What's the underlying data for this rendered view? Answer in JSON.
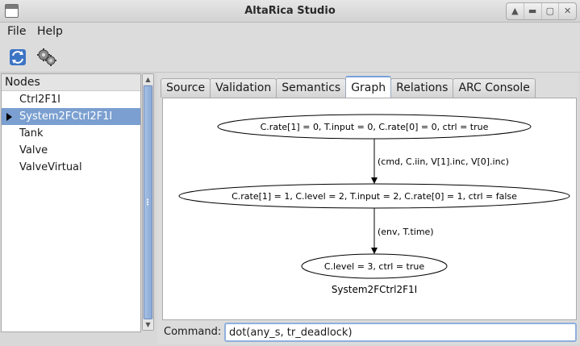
{
  "window": {
    "title": "AltaRica Studio",
    "controls": [
      "▲",
      "▬",
      "▢",
      "✕"
    ]
  },
  "menu": {
    "file": "File",
    "help": "Help"
  },
  "toolbar": {
    "refresh_icon": "refresh-icon",
    "settings_icon": "gears-icon"
  },
  "nodes": {
    "header": "Nodes",
    "items": [
      {
        "label": "Ctrl2F1I"
      },
      {
        "label": "System2FCtrl2F1I"
      },
      {
        "label": "Tank"
      },
      {
        "label": "Valve"
      },
      {
        "label": "ValveVirtual"
      }
    ]
  },
  "tabs": [
    {
      "label": "Source"
    },
    {
      "label": "Validation"
    },
    {
      "label": "Semantics"
    },
    {
      "label": "Graph"
    },
    {
      "label": "Relations"
    },
    {
      "label": "ARC Console"
    }
  ],
  "graph": {
    "states": [
      "C.rate[1] = 0, T.input = 0, C.rate[0] = 0, ctrl = true",
      "C.rate[1] = 1, C.level = 2, T.input = 2, C.rate[0] = 1, ctrl = false",
      "C.level = 3, ctrl = true"
    ],
    "transitions": [
      "(cmd, C.iin, V[1].inc, V[0].inc)",
      "(env, T.time)"
    ],
    "caption": "System2FCtrl2F1I"
  },
  "command": {
    "label": "Command:",
    "value": "dot(any_s, tr_deadlock)"
  }
}
